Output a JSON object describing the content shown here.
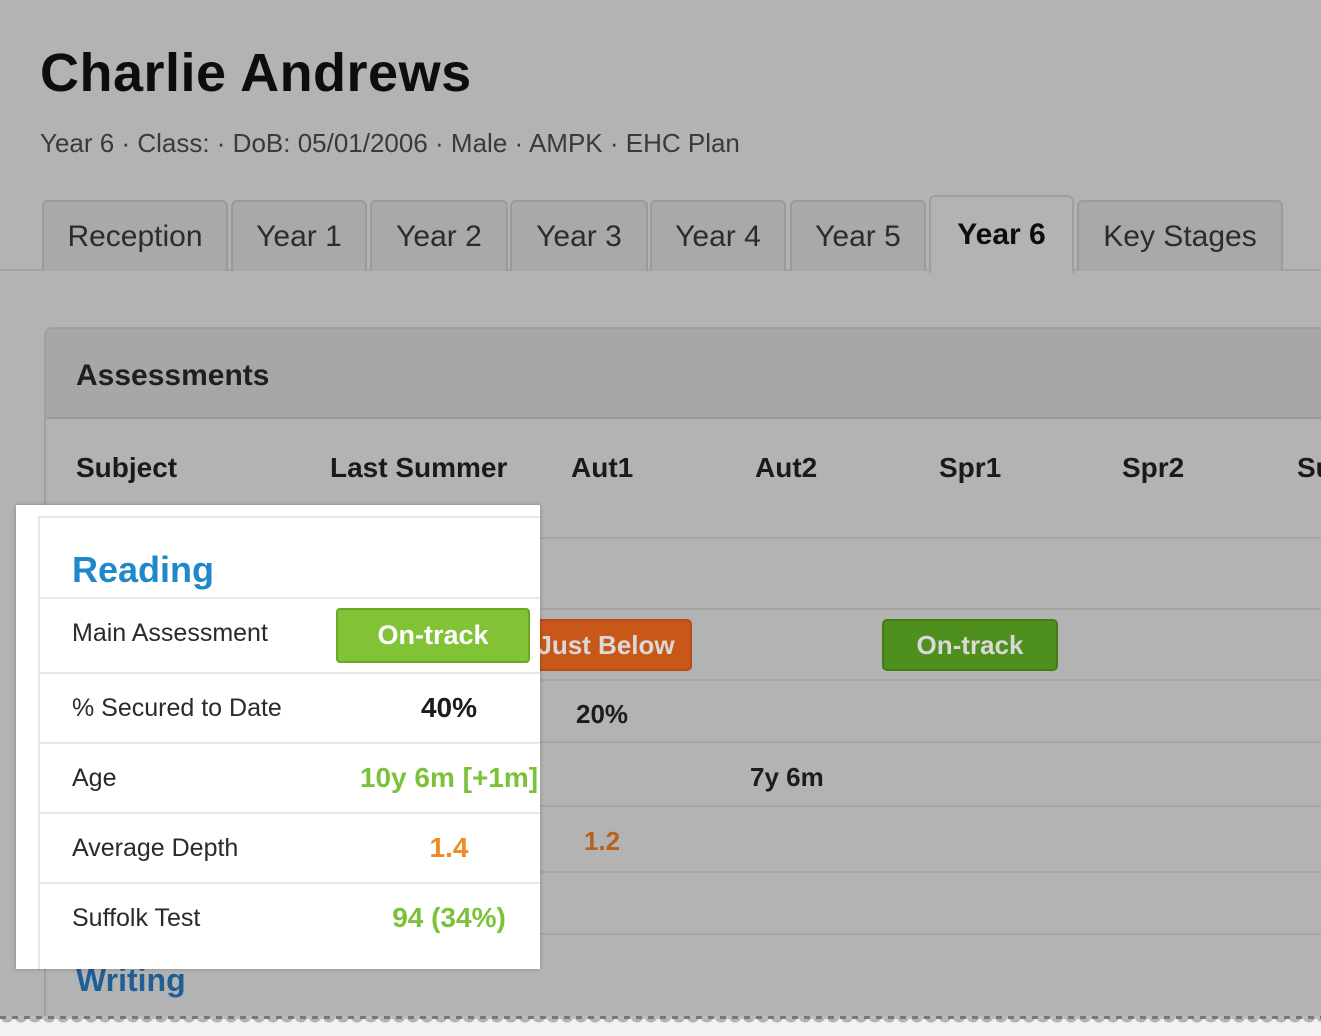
{
  "student": {
    "name": "Charlie Andrews",
    "meta": "Year 6 · Class: · DoB: 05/01/2006 · Male · AMPK · EHC Plan"
  },
  "tabs": [
    {
      "label": "Reception",
      "active": false
    },
    {
      "label": "Year 1",
      "active": false
    },
    {
      "label": "Year 2",
      "active": false
    },
    {
      "label": "Year 3",
      "active": false
    },
    {
      "label": "Year 4",
      "active": false
    },
    {
      "label": "Year 5",
      "active": false
    },
    {
      "label": "Year 6",
      "active": true
    },
    {
      "label": "Key Stages",
      "active": false
    }
  ],
  "assessments": {
    "title": "Assessments",
    "columns": [
      "Subject",
      "Last Summer",
      "Aut1",
      "Aut2",
      "Spr1",
      "Spr2",
      "Su"
    ],
    "background_values": {
      "aut1_main": "Just Below",
      "spr1_main": "On-track",
      "aut1_secured": "20%",
      "aut2_age": "7y 6m",
      "aut1_depth": "1.2"
    },
    "next_subject": "Writing"
  },
  "highlight": {
    "subject": "Reading",
    "rows": [
      {
        "label": "Main Assessment",
        "value": "On-track"
      },
      {
        "label": "% Secured to Date",
        "value": "40%"
      },
      {
        "label": "Age",
        "value": "10y 6m [+1m]"
      },
      {
        "label": "Average Depth",
        "value": "1.4"
      },
      {
        "label": "Suffolk Test",
        "value": "94 (34%)"
      }
    ]
  },
  "colors": {
    "on_track": "#82c235",
    "just_below": "#e06a1b",
    "depth_orange": "#f08a24",
    "age_green": "#7cc13a",
    "link_blue": "#1e88c8"
  }
}
